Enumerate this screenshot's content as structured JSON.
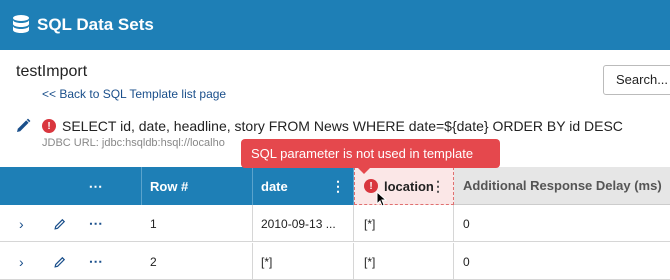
{
  "app": {
    "title": "SQL Data Sets",
    "icon": "database-icon"
  },
  "page": {
    "title": "testImport",
    "back_link": "<< Back to SQL Template list page",
    "search_label": "Search..."
  },
  "template": {
    "sql": "SELECT id, date, headline, story FROM News WHERE date=${date} ORDER BY id DESC",
    "jdbc": "JDBC URL: jdbc:hsqldb:hsql://localho",
    "error_icon": "!"
  },
  "tooltip": {
    "text": "SQL parameter is not used in template"
  },
  "table": {
    "headers": {
      "actions": "⋯",
      "row": "Row #",
      "date": "date",
      "location": "location",
      "delay": "Additional Response Delay (ms)",
      "kebab": "⋮"
    },
    "rows": [
      {
        "row": "1",
        "date": "2010-09-13 ...",
        "location": "[*]",
        "delay": "0"
      },
      {
        "row": "2",
        "date": "[*]",
        "location": "[*]",
        "delay": "0"
      }
    ],
    "row_actions": {
      "expand": "›",
      "more": "⋯"
    }
  },
  "colors": {
    "header_blue": "#1e7fb6",
    "error_red": "#d9363e",
    "tooltip_red": "#e5484d",
    "link_blue": "#1a4f8b"
  }
}
